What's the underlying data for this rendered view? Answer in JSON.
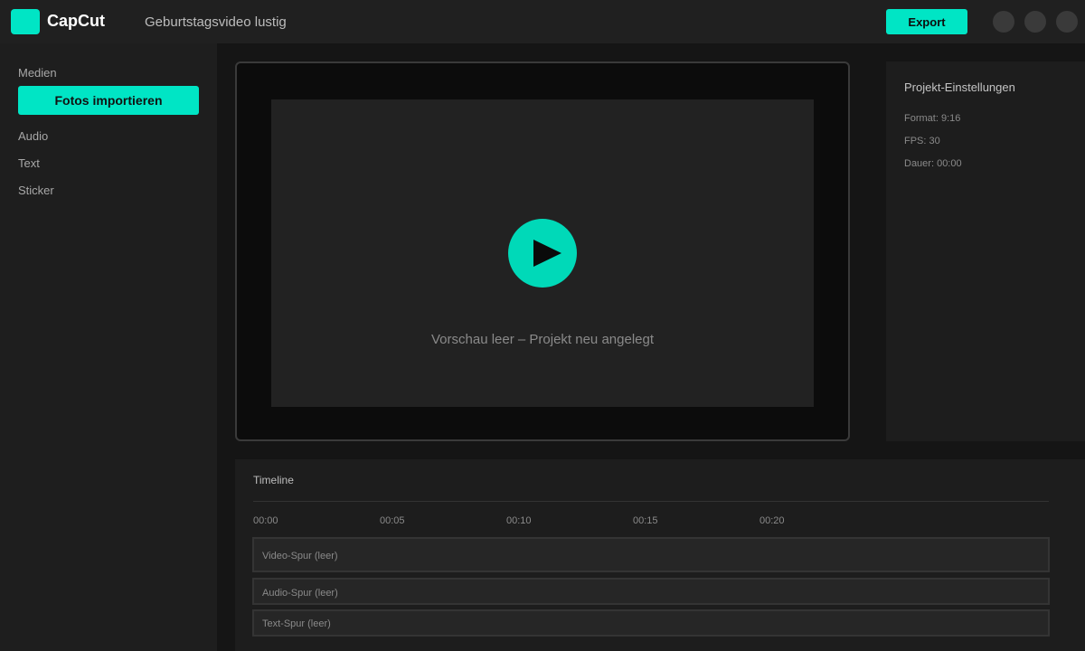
{
  "header": {
    "app_name": "CapCut",
    "project_title": "Geburtstagsvideo lustig",
    "export_label": "Export",
    "window_controls": [
      "minimize-icon",
      "maximize-icon",
      "close-icon"
    ]
  },
  "sidebar": {
    "media_label": "Medien",
    "import_button_label": "Fotos importieren",
    "items": [
      {
        "label": "Audio"
      },
      {
        "label": "Text"
      },
      {
        "label": "Sticker"
      }
    ]
  },
  "preview": {
    "message": "Vorschau leer – Projekt neu angelegt",
    "play_icon": "play-icon"
  },
  "settings": {
    "title": "Projekt-Einstellungen",
    "format": "Format: 9:16",
    "fps": "FPS: 30",
    "duration": "Dauer: 00:00"
  },
  "timeline": {
    "title": "Timeline",
    "ticks": [
      "00:00",
      "00:05",
      "00:10",
      "00:15",
      "00:20"
    ],
    "tracks": [
      {
        "label": "Video-Spur (leer)"
      },
      {
        "label": "Audio-Spur (leer)"
      },
      {
        "label": "Text-Spur (leer)"
      }
    ]
  },
  "colors": {
    "accent": "#00e5c5",
    "background": "#151515",
    "panel": "#1e1e1e"
  }
}
